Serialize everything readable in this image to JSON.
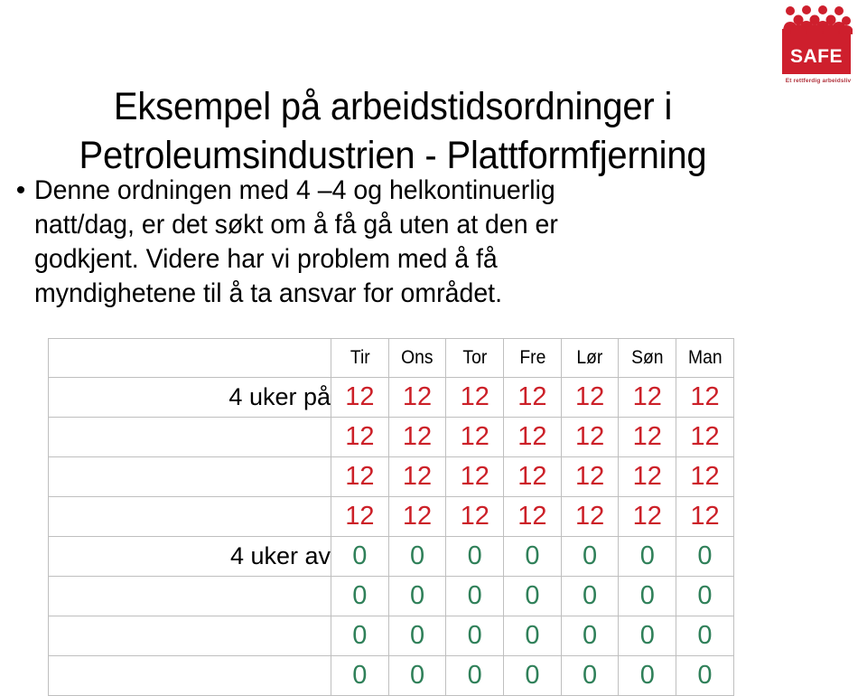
{
  "logo": {
    "name": "SAFE",
    "tagline": "Et rettferdig arbeidsliv",
    "brand_color": "#CE1F2D",
    "tagline_color": "#B0323C"
  },
  "title": {
    "line1": "Eksempel på arbeidstidsordninger i",
    "line2": "Petroleumsindustrien - Plattformfjerning"
  },
  "body": {
    "bullet_glyph": "•",
    "text": "Denne ordningen med 4 –4 og helkontinuerlig natt/dag, er det søkt om å få gå uten at den er godkjent. Videre har vi problem med å få myndighetene til å ta ansvar for området."
  },
  "schedule": {
    "day_headers": [
      "Tir",
      "Ons",
      "Tor",
      "Fre",
      "Lør",
      "Søn",
      "Man"
    ],
    "on_color": "#CC2028",
    "off_color": "#2F8059",
    "rows": [
      {
        "label": "4 uker på",
        "values": [
          "12",
          "12",
          "12",
          "12",
          "12",
          "12",
          "12"
        ],
        "state": "on"
      },
      {
        "label": "",
        "values": [
          "12",
          "12",
          "12",
          "12",
          "12",
          "12",
          "12"
        ],
        "state": "on"
      },
      {
        "label": "",
        "values": [
          "12",
          "12",
          "12",
          "12",
          "12",
          "12",
          "12"
        ],
        "state": "on"
      },
      {
        "label": "",
        "values": [
          "12",
          "12",
          "12",
          "12",
          "12",
          "12",
          "12"
        ],
        "state": "on"
      },
      {
        "label": "4 uker av",
        "values": [
          "0",
          "0",
          "0",
          "0",
          "0",
          "0",
          "0"
        ],
        "state": "off"
      },
      {
        "label": "",
        "values": [
          "0",
          "0",
          "0",
          "0",
          "0",
          "0",
          "0"
        ],
        "state": "off"
      },
      {
        "label": "",
        "values": [
          "0",
          "0",
          "0",
          "0",
          "0",
          "0",
          "0"
        ],
        "state": "off"
      },
      {
        "label": "",
        "values": [
          "0",
          "0",
          "0",
          "0",
          "0",
          "0",
          "0"
        ],
        "state": "off"
      }
    ]
  }
}
